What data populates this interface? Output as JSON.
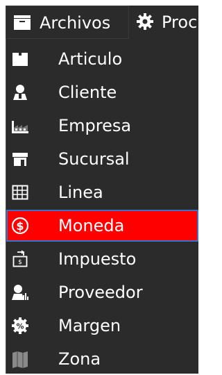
{
  "menubar": {
    "archivos_label": "Archivos",
    "archivos_icon": "folder-icon",
    "proc_label": "Proc",
    "proc_icon": "gear-icon"
  },
  "dropdown": {
    "items": [
      {
        "label": "Articulo",
        "icon": "box-icon"
      },
      {
        "label": "Cliente",
        "icon": "person-icon"
      },
      {
        "label": "Empresa",
        "icon": "factory-icon"
      },
      {
        "label": "Sucursal",
        "icon": "store-icon"
      },
      {
        "label": "Linea",
        "icon": "grid-icon"
      },
      {
        "label": "Moneda",
        "icon": "currency-icon",
        "highlighted": true
      },
      {
        "label": "Impuesto",
        "icon": "tax-icon"
      },
      {
        "label": "Proveedor",
        "icon": "supplier-icon"
      },
      {
        "label": "Margen",
        "icon": "percent-icon"
      },
      {
        "label": "Zona",
        "icon": "map-icon"
      }
    ]
  },
  "colors": {
    "menu_bg": "#2b2b2b",
    "highlight_bg": "#ff0000",
    "highlight_border": "#3b73c8",
    "text": "#ffffff"
  }
}
